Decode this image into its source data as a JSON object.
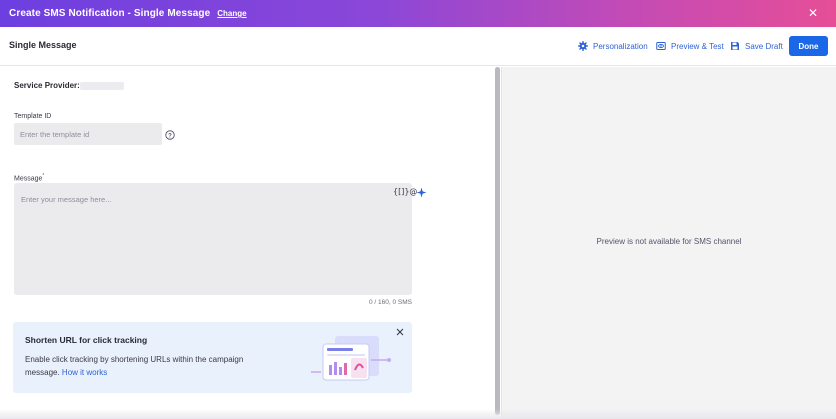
{
  "titlebar": {
    "title": "Create SMS Notification - Single Message",
    "change_label": "Change",
    "close_icon": "close-icon",
    "gradient_start": "#6d3fe0",
    "gradient_end": "#e64e97"
  },
  "header": {
    "page_title": "Single Message",
    "actions": [
      {
        "label": "Personalization",
        "icon": "gear-icon"
      },
      {
        "label": "Preview & Test",
        "icon": "eye-icon"
      },
      {
        "label": "Save Draft",
        "icon": "save-icon"
      }
    ],
    "done_label": "Done",
    "accent": "#1a67e8"
  },
  "form": {
    "service_provider_label": "Service Provider:",
    "template_id_label": "Template ID",
    "template_id_placeholder": "Enter the template id",
    "template_id_value": "",
    "message_label": "Message",
    "message_required_mark": "*",
    "message_placeholder": "Enter your message here...",
    "message_value": "",
    "variable_icon_text": "{[]}@",
    "counter": "0 / 160, 0 SMS"
  },
  "banner": {
    "title": "Shorten URL for click tracking",
    "text": "Enable click tracking by shortening URLs within the campaign message.",
    "link": "How it works"
  },
  "preview": {
    "message": "Preview is not available for SMS channel"
  }
}
